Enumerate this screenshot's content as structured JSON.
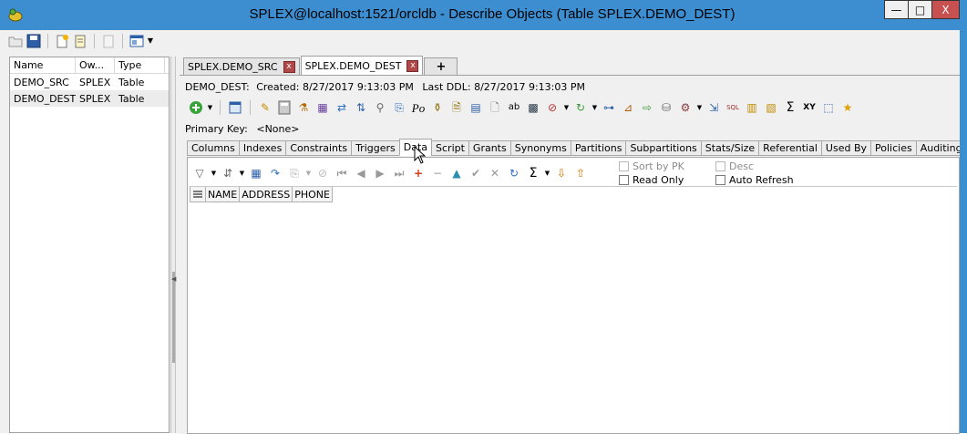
{
  "window": {
    "title": "SPLEX@localhost:1521/orcldb - Describe Objects (Table SPLEX.DEMO_DEST)",
    "minimize": "—",
    "maximize": "□",
    "close": "X"
  },
  "main_toolbar": [
    "open-icon",
    "save-icon",
    "new-icon",
    "copy-icon",
    "page-icon",
    "grid-view-icon"
  ],
  "object_list": {
    "columns": [
      "Name",
      "Ow...",
      "Type"
    ],
    "rows": [
      {
        "name": "DEMO_SRC",
        "owner": "SPLEX",
        "type": "Table"
      },
      {
        "name": "DEMO_DEST",
        "owner": "SPLEX",
        "type": "Table"
      }
    ]
  },
  "document_tabs": [
    {
      "label": "SPLEX.DEMO_SRC",
      "close": "x"
    },
    {
      "label": "SPLEX.DEMO_DEST",
      "close": "x"
    }
  ],
  "add_tab": "+",
  "info": {
    "object": "DEMO_DEST:",
    "created_label": "Created:",
    "created": "8/27/2017 9:13:03 PM",
    "last_ddl_label": "Last DDL:",
    "last_ddl": "8/27/2017 9:13:03 PM"
  },
  "primary_key": {
    "label": "Primary Key:",
    "value": "<None>"
  },
  "sub_tabs": [
    "Columns",
    "Indexes",
    "Constraints",
    "Triggers",
    "Data",
    "Script",
    "Grants",
    "Synonyms",
    "Partitions",
    "Subpartitions",
    "Stats/Size",
    "Referential",
    "Used By",
    "Policies",
    "Auditing"
  ],
  "active_sub_tab": "Data",
  "data_options": {
    "sort_by_pk": "Sort by PK",
    "read_only": "Read Only",
    "desc": "Desc",
    "auto_refresh": "Auto Refresh"
  },
  "grid_columns": [
    "NAME",
    "ADDRESS",
    "PHONE"
  ],
  "colors": {
    "title_bar": "#3d8ed1",
    "close_button": "#c75050",
    "tab_close": "#b04848"
  }
}
